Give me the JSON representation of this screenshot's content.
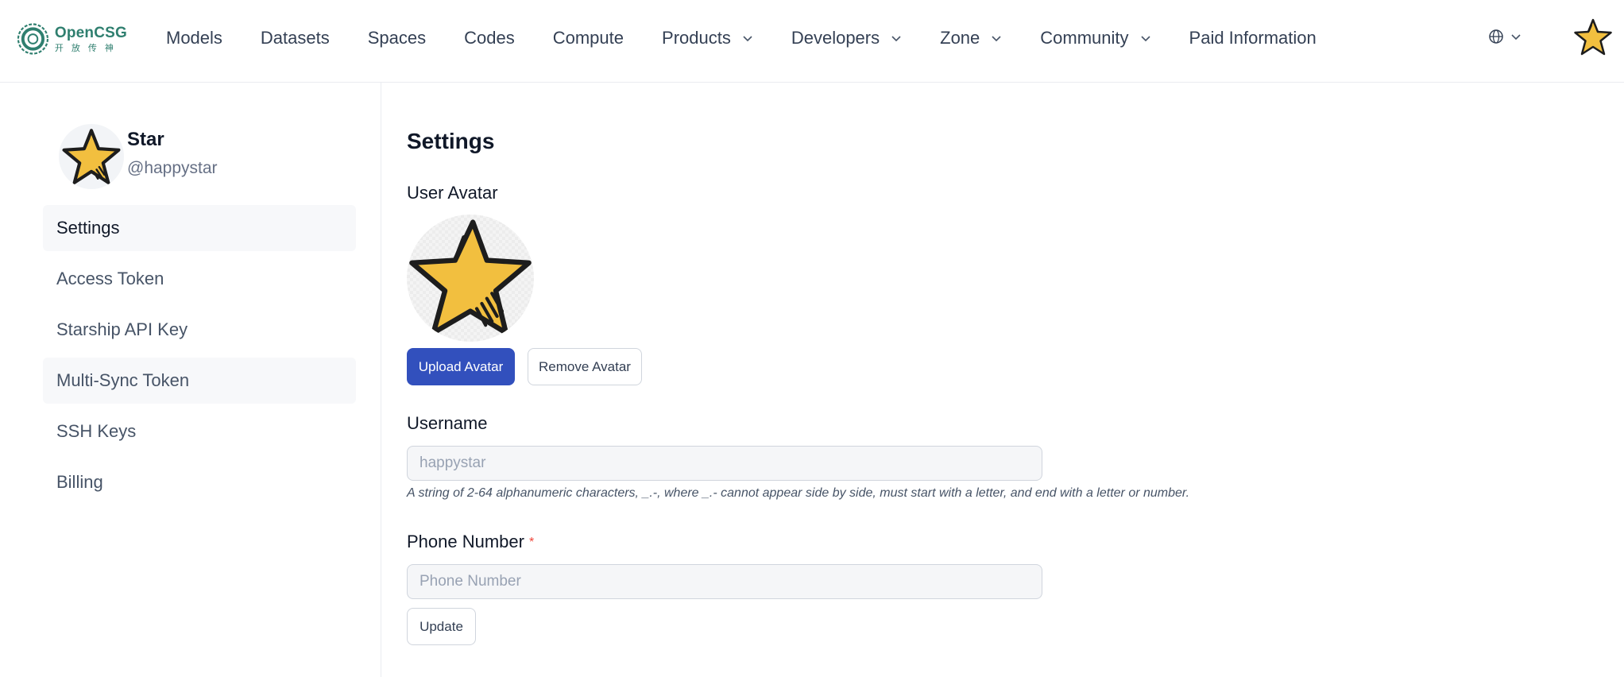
{
  "brand": {
    "name": "OpenCSG",
    "subtitle": "开放传神",
    "accent": "#2f7f6f"
  },
  "nav": {
    "items": [
      {
        "label": "Models",
        "dropdown": false
      },
      {
        "label": "Datasets",
        "dropdown": false
      },
      {
        "label": "Spaces",
        "dropdown": false
      },
      {
        "label": "Codes",
        "dropdown": false
      },
      {
        "label": "Compute",
        "dropdown": false
      },
      {
        "label": "Products",
        "dropdown": true
      },
      {
        "label": "Developers",
        "dropdown": true
      },
      {
        "label": "Zone",
        "dropdown": true
      },
      {
        "label": "Community",
        "dropdown": true
      },
      {
        "label": "Paid Information",
        "dropdown": false
      }
    ],
    "language_icon": "globe-icon",
    "user_avatar_icon": "star-icon"
  },
  "profile": {
    "name": "Star",
    "handle": "@happystar"
  },
  "sidebar": {
    "items": [
      {
        "label": "Settings",
        "active": true
      },
      {
        "label": "Access Token",
        "active": false
      },
      {
        "label": "Starship API Key",
        "active": false
      },
      {
        "label": "Multi-Sync Token",
        "active": false,
        "hovered": true
      },
      {
        "label": "SSH Keys",
        "active": false
      },
      {
        "label": "Billing",
        "active": false
      }
    ]
  },
  "settings": {
    "title": "Settings",
    "avatar_label": "User Avatar",
    "upload_button": "Upload Avatar",
    "remove_button": "Remove Avatar",
    "username_label": "Username",
    "username_value": "happystar",
    "username_hint": "A string of 2-64 alphanumeric characters, _.-, where _.- cannot appear side by side, must start with a letter, and end with a letter or number.",
    "phone_label": "Phone Number",
    "phone_required": "*",
    "phone_placeholder": "Phone Number",
    "update_button": "Update"
  },
  "colors": {
    "primary": "#3250bd",
    "star_fill": "#f2bf3f",
    "required": "#f04438"
  }
}
